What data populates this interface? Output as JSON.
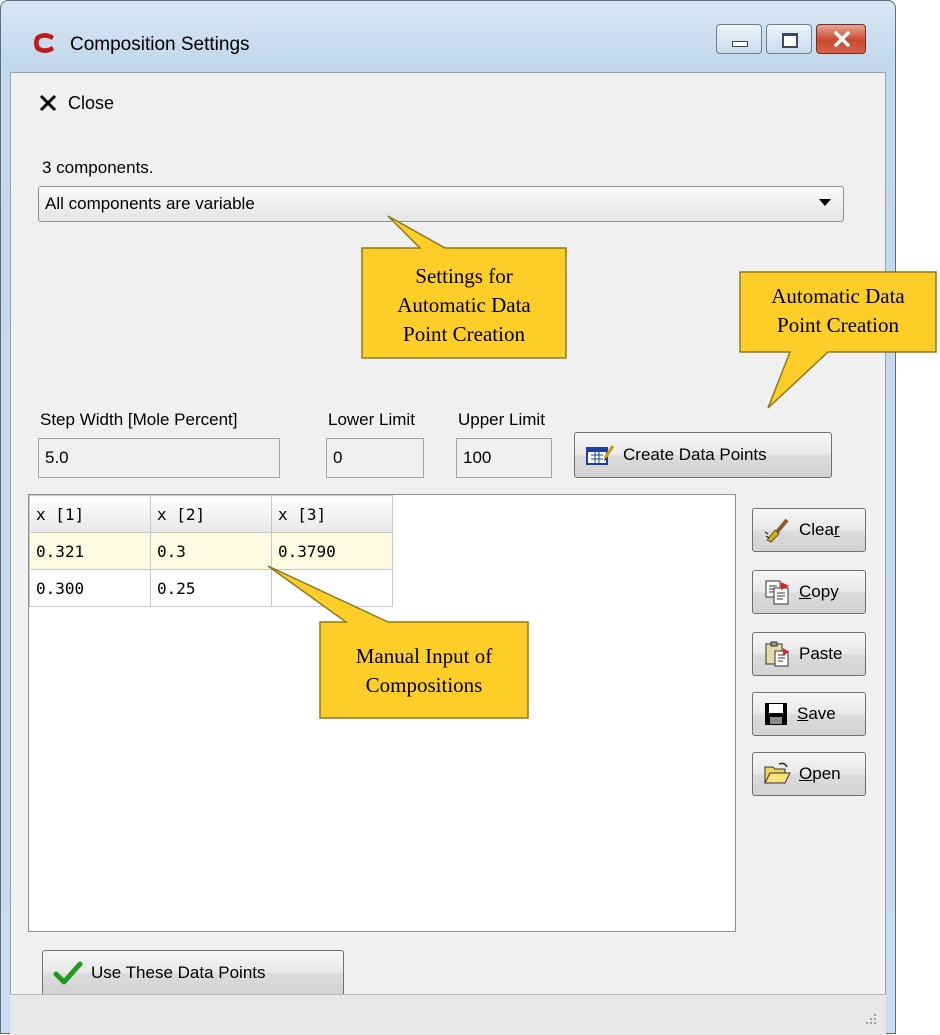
{
  "window": {
    "title": "Composition Settings",
    "colors": {
      "callout_fill": "#fece28",
      "callout_border": "#8b7a1a",
      "selected_row": "#fefbe2"
    }
  },
  "toolbar": {
    "close_label": "Close"
  },
  "components": {
    "count_label": "3 components.",
    "mode_value": "All components are variable"
  },
  "auto": {
    "step_label": "Step Width [Mole Percent]",
    "step_value": "5.0",
    "lower_label": "Lower Limit",
    "lower_value": "0",
    "upper_label": "Upper Limit",
    "upper_value": "100",
    "create_label": "Create Data Points"
  },
  "grid": {
    "headers": [
      "x [1]",
      "x [2]",
      "x [3]"
    ],
    "rows": [
      [
        "0.321",
        "0.3",
        "0.3790"
      ],
      [
        "0.300",
        "0.25",
        ""
      ]
    ]
  },
  "side_buttons": {
    "clear_pre": "Clea",
    "clear_u": "r",
    "clear_post": "",
    "copy_pre": "",
    "copy_u": "C",
    "copy_post": "opy",
    "paste_label": "Paste",
    "save_pre": "",
    "save_u": "S",
    "save_post": "ave",
    "open_pre": "",
    "open_u": "O",
    "open_post": "pen"
  },
  "use_button": {
    "label": "Use These Data Points"
  },
  "callouts": {
    "settings": [
      "Settings for",
      "Automatic Data",
      "Point Creation"
    ],
    "create": [
      "Automatic Data",
      "Point Creation"
    ],
    "manual": [
      "Manual Input of",
      "Compositions"
    ]
  },
  "icons": [
    "app-logo-icon",
    "minimize-icon",
    "maximize-icon",
    "close-window-icon",
    "close-x-icon",
    "dropdown-arrow-icon",
    "create-points-icon",
    "clear-brush-icon",
    "copy-icon",
    "paste-icon",
    "save-disk-icon",
    "open-folder-icon",
    "checkmark-icon",
    "resize-grip-icon"
  ]
}
